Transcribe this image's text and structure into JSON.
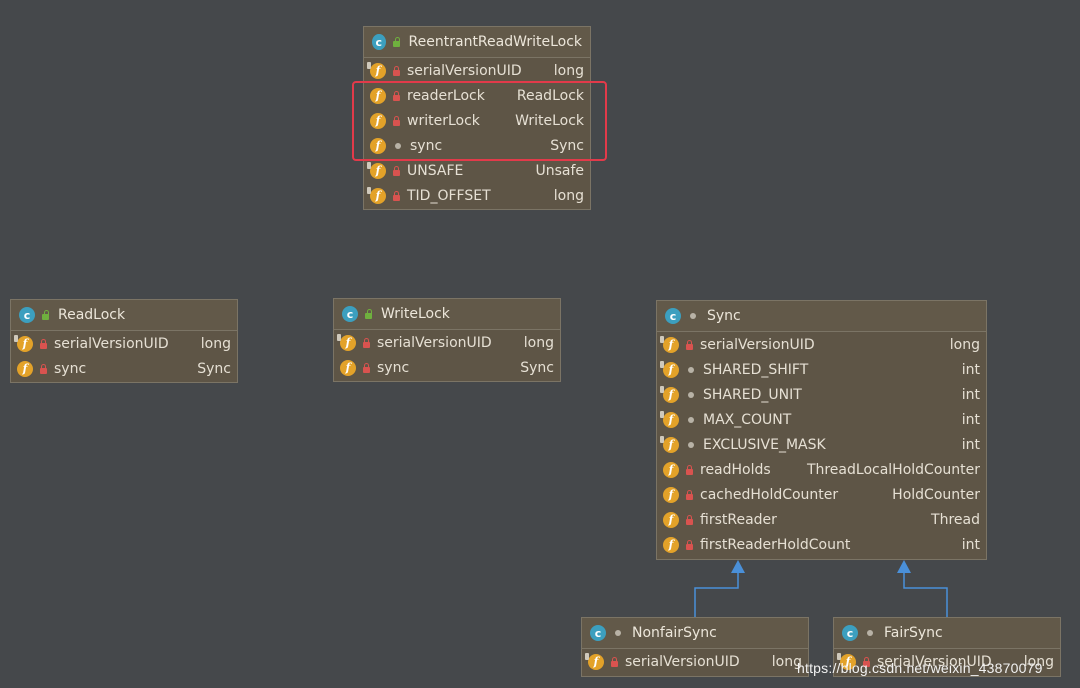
{
  "nodes": {
    "rrwl": {
      "title": "ReentrantReadWriteLock",
      "fields": [
        {
          "name": "serialVersionUID",
          "type": "long"
        },
        {
          "name": "readerLock",
          "type": "ReadLock"
        },
        {
          "name": "writerLock",
          "type": "WriteLock"
        },
        {
          "name": "sync",
          "type": "Sync"
        },
        {
          "name": "UNSAFE",
          "type": "Unsafe"
        },
        {
          "name": "TID_OFFSET",
          "type": "long"
        }
      ]
    },
    "readlock": {
      "title": "ReadLock",
      "fields": [
        {
          "name": "serialVersionUID",
          "type": "long"
        },
        {
          "name": "sync",
          "type": "Sync"
        }
      ]
    },
    "writelock": {
      "title": "WriteLock",
      "fields": [
        {
          "name": "serialVersionUID",
          "type": "long"
        },
        {
          "name": "sync",
          "type": "Sync"
        }
      ]
    },
    "sync": {
      "title": "Sync",
      "fields": [
        {
          "name": "serialVersionUID",
          "type": "long"
        },
        {
          "name": "SHARED_SHIFT",
          "type": "int"
        },
        {
          "name": "SHARED_UNIT",
          "type": "int"
        },
        {
          "name": "MAX_COUNT",
          "type": "int"
        },
        {
          "name": "EXCLUSIVE_MASK",
          "type": "int"
        },
        {
          "name": "readHolds",
          "type": "ThreadLocalHoldCounter"
        },
        {
          "name": "cachedHoldCounter",
          "type": "HoldCounter"
        },
        {
          "name": "firstReader",
          "type": "Thread"
        },
        {
          "name": "firstReaderHoldCount",
          "type": "int"
        }
      ]
    },
    "nonfair": {
      "title": "NonfairSync",
      "fields": [
        {
          "name": "serialVersionUID",
          "type": "long"
        }
      ]
    },
    "fair": {
      "title": "FairSync",
      "fields": [
        {
          "name": "serialVersionUID",
          "type": "long"
        }
      ]
    }
  },
  "icons": {
    "class": "class-icon",
    "field": "field-icon",
    "private": "lock-icon",
    "public": "unlock-icon",
    "package": "package-dot-icon"
  },
  "colors": {
    "background": "#45484b",
    "node_fill": "#5e5546",
    "highlight": "#e23a4a",
    "edge": "#4a90d9"
  },
  "watermark": "https://blog.csdn.net/weixin_43870079"
}
